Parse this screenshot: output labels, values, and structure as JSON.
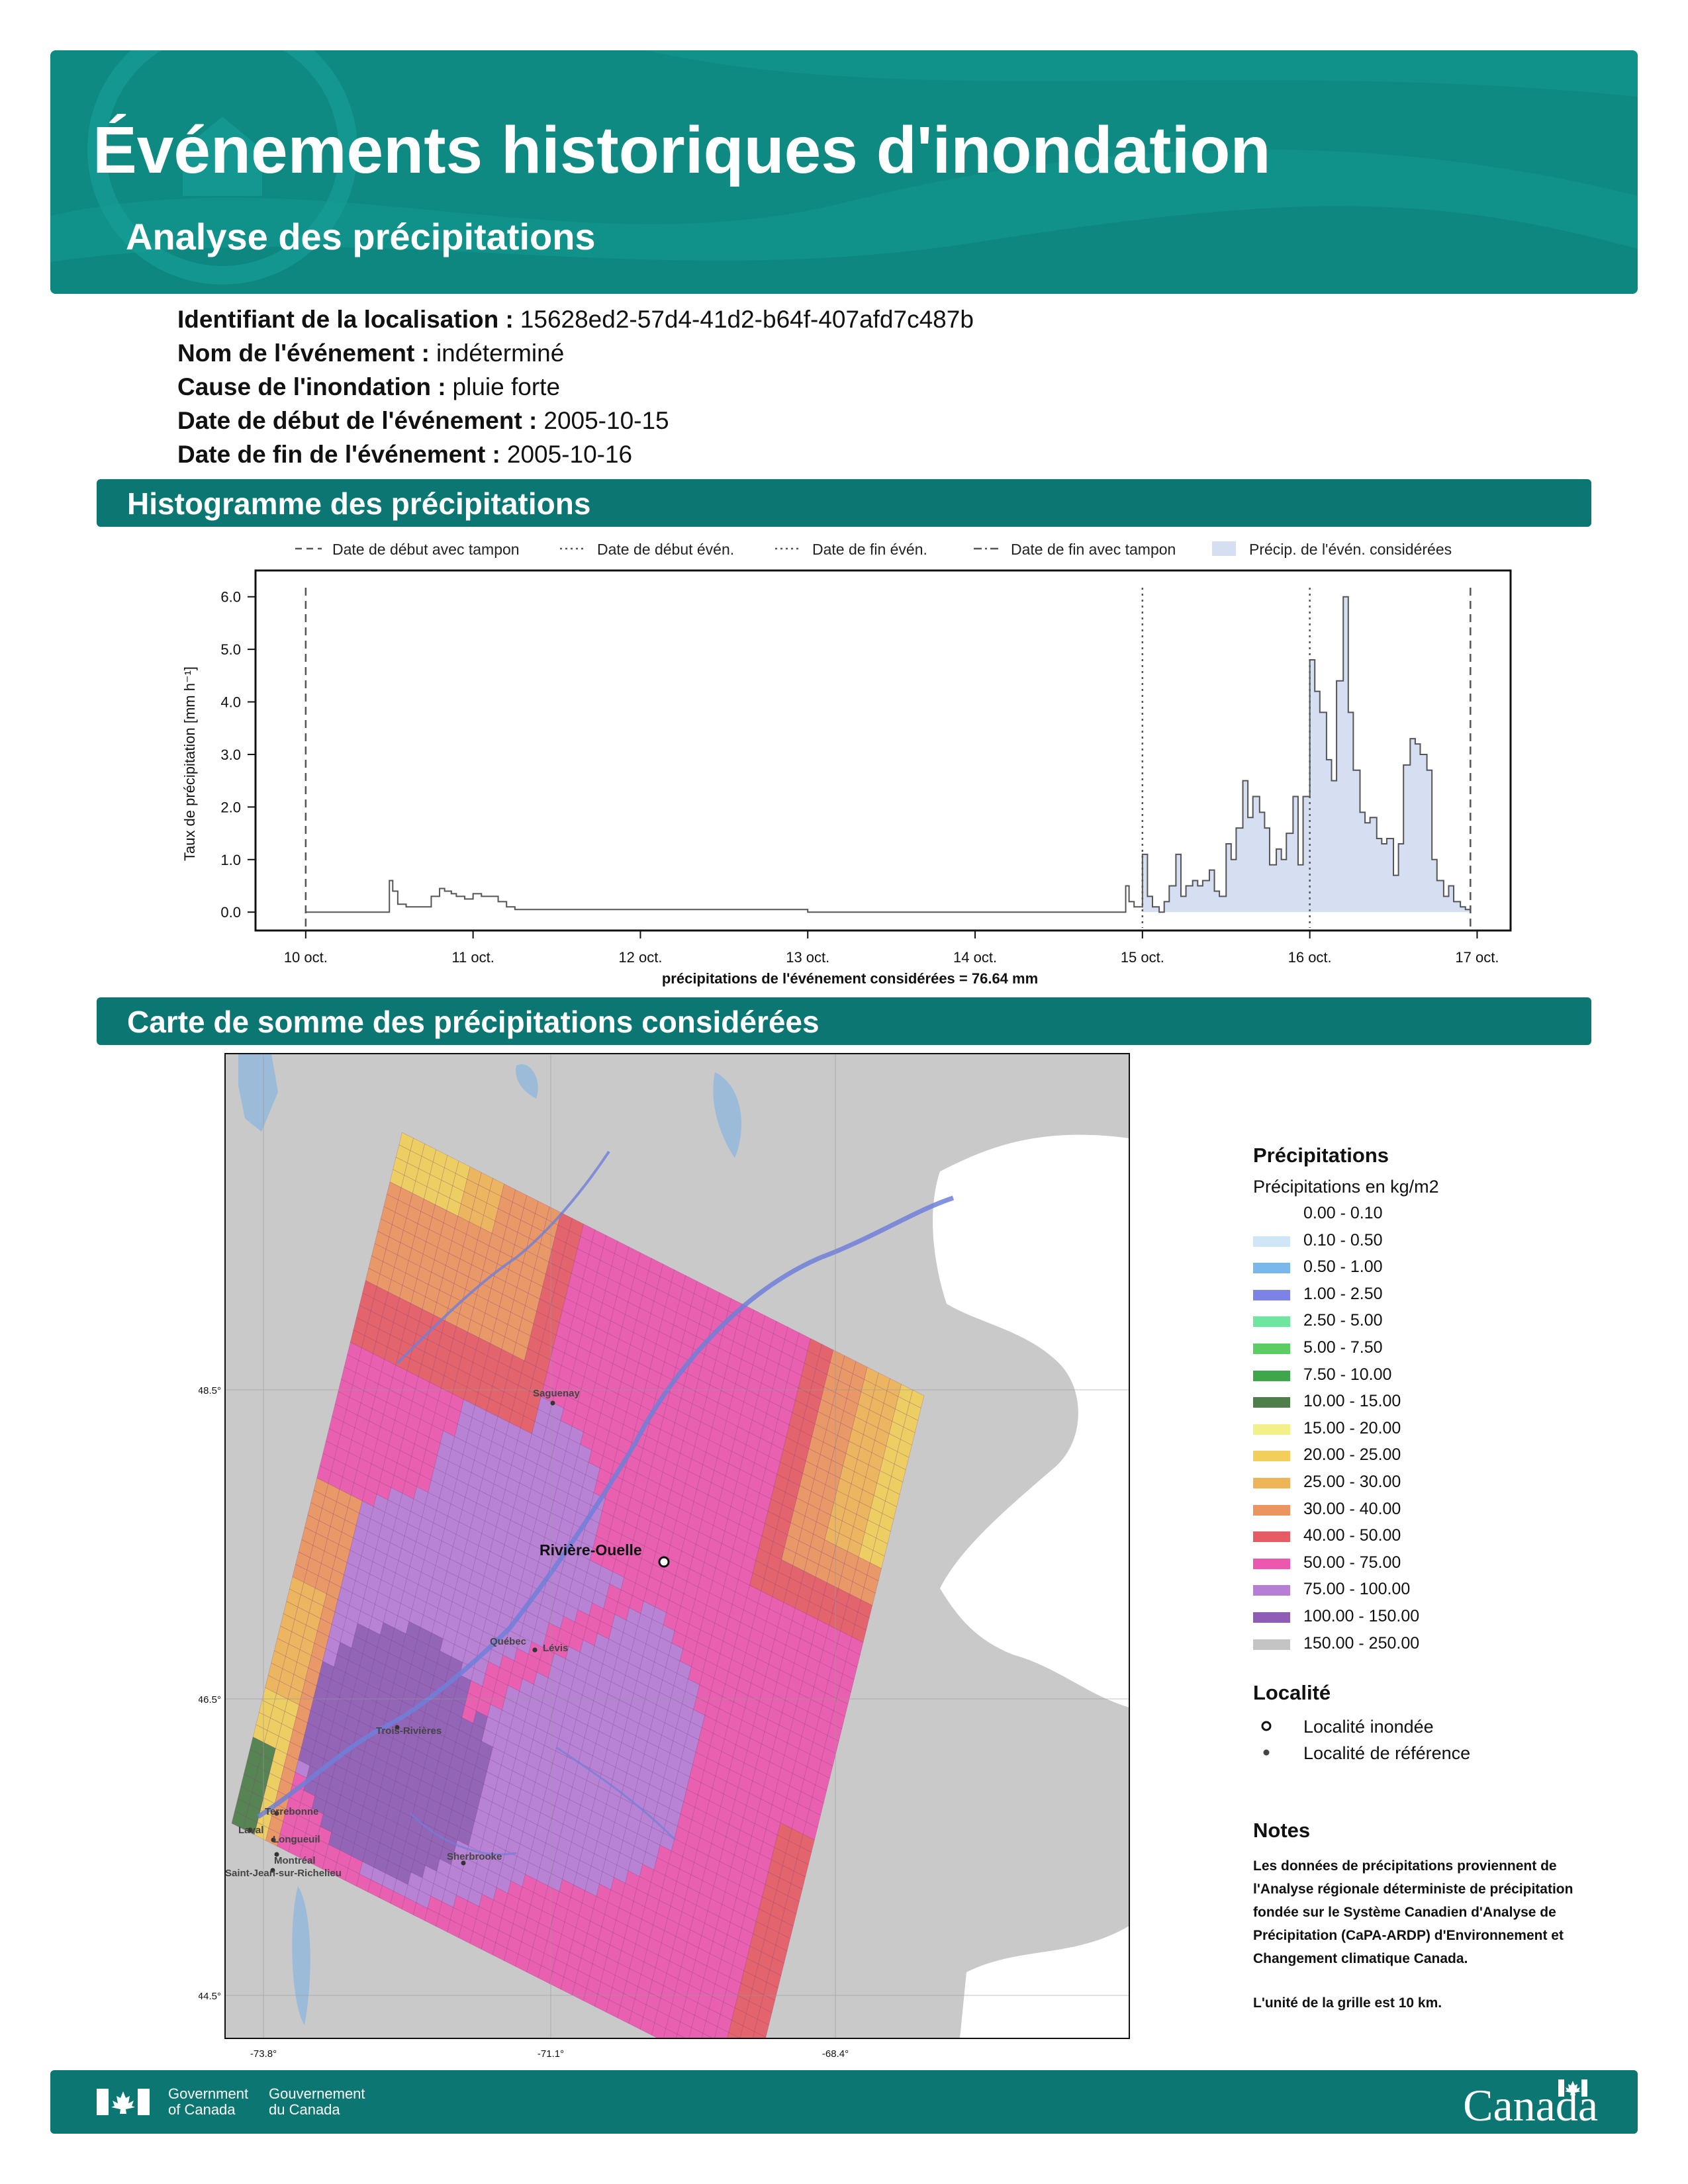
{
  "header": {
    "title": "Événements historiques d'inondation",
    "subtitle": "Analyse des précipitations",
    "brand_color": "#0e8a83",
    "section_color": "#0b7672"
  },
  "info": [
    {
      "label": "Identifiant de la localisation :",
      "value": "15628ed2-57d4-41d2-b64f-407afd7c487b"
    },
    {
      "label": "Nom de l'événement :",
      "value": "indéterminé"
    },
    {
      "label": "Cause de l'inondation :",
      "value": "pluie forte"
    },
    {
      "label": "Date de début de l'événement :",
      "value": "2005-10-15"
    },
    {
      "label": "Date de fin de l'événement :",
      "value": "2005-10-16"
    }
  ],
  "sections": {
    "histogram": "Histogramme des précipitations",
    "map": "Carte de somme des précipitations considérées"
  },
  "chart_data": {
    "type": "line",
    "ylabel": "Taux de précipitation [mm h⁻¹]",
    "xlabel": "précipitations de l'événement considérées = 76.64 mm",
    "ylim": [
      0,
      6.5
    ],
    "xlim_days": [
      9.7,
      17.2
    ],
    "yticks": [
      0.0,
      1.0,
      2.0,
      3.0,
      4.0,
      5.0,
      6.0
    ],
    "ytick_labels": [
      "0.0",
      "1.0",
      "2.0",
      "3.0",
      "4.0",
      "5.0",
      "6.0"
    ],
    "xticks": [
      10,
      11,
      12,
      13,
      14,
      15,
      16,
      17
    ],
    "xtick_labels": [
      "10 oct.",
      "11 oct.",
      "12 oct.",
      "13 oct.",
      "14 oct.",
      "15 oct.",
      "16 oct.",
      "17 oct."
    ],
    "legend": [
      {
        "label": "Date de début avec tampon",
        "style": "dashed"
      },
      {
        "label": "Date de début évén.",
        "style": "dotted"
      },
      {
        "label": "Date de fin évén.",
        "style": "dotted"
      },
      {
        "label": "Date de fin avec tampon",
        "style": "dashdot"
      },
      {
        "label": "Précip. de l'évén. considérées",
        "style": "fill"
      }
    ],
    "legend_position": "top",
    "grid": false,
    "vlines": [
      {
        "x": 10.0,
        "style": "dashed"
      },
      {
        "x": 15.0,
        "style": "dotted"
      },
      {
        "x": 16.0,
        "style": "dotted"
      },
      {
        "x": 16.96,
        "style": "dashed"
      }
    ],
    "fill_range": [
      15.0,
      16.96
    ],
    "fill_color": "#d5dff1",
    "x": [
      10.0,
      10.5,
      10.52,
      10.55,
      10.6,
      10.7,
      10.75,
      10.8,
      10.83,
      10.87,
      10.9,
      10.95,
      11.0,
      11.05,
      11.1,
      11.15,
      11.2,
      11.25,
      11.3,
      11.35,
      11.5,
      12.0,
      12.5,
      13.0,
      13.5,
      14.0,
      14.5,
      14.9,
      14.92,
      14.95,
      15.0,
      15.03,
      15.06,
      15.1,
      15.13,
      15.16,
      15.2,
      15.23,
      15.26,
      15.3,
      15.33,
      15.36,
      15.4,
      15.43,
      15.46,
      15.5,
      15.53,
      15.56,
      15.6,
      15.63,
      15.66,
      15.7,
      15.73,
      15.76,
      15.8,
      15.83,
      15.86,
      15.9,
      15.93,
      15.96,
      16.0,
      16.03,
      16.06,
      16.1,
      16.13,
      16.16,
      16.2,
      16.23,
      16.26,
      16.3,
      16.33,
      16.36,
      16.4,
      16.43,
      16.46,
      16.5,
      16.53,
      16.56,
      16.6,
      16.63,
      16.66,
      16.7,
      16.73,
      16.76,
      16.8,
      16.83,
      16.86,
      16.9,
      16.93
    ],
    "y": [
      0.0,
      0.6,
      0.4,
      0.15,
      0.1,
      0.1,
      0.3,
      0.45,
      0.4,
      0.35,
      0.3,
      0.25,
      0.35,
      0.3,
      0.3,
      0.2,
      0.1,
      0.05,
      0.05,
      0.05,
      0.05,
      0.05,
      0.05,
      0.0,
      0.0,
      0.0,
      0.0,
      0.5,
      0.2,
      0.1,
      1.1,
      0.3,
      0.1,
      0.0,
      0.2,
      0.5,
      1.1,
      0.3,
      0.5,
      0.6,
      0.5,
      0.6,
      0.8,
      0.4,
      0.3,
      1.3,
      1.0,
      1.6,
      2.5,
      1.8,
      2.2,
      1.9,
      1.6,
      0.9,
      1.2,
      1.0,
      1.5,
      2.2,
      0.9,
      2.2,
      4.8,
      4.2,
      3.8,
      2.9,
      2.5,
      4.4,
      6.0,
      3.8,
      2.7,
      1.9,
      1.7,
      1.8,
      1.4,
      1.3,
      1.4,
      0.7,
      1.3,
      2.8,
      3.3,
      3.2,
      3.0,
      2.7,
      1.0,
      0.6,
      0.3,
      0.5,
      0.2,
      0.1,
      0.05
    ]
  },
  "map": {
    "lat_labels": [
      "+48.5°",
      "+46.5°",
      "+44.5°"
    ],
    "lon_labels": [
      "-73.8°",
      "-71.1°",
      "-68.4°"
    ],
    "flood_locality": "Rivière-Ouelle",
    "reference_localities": [
      "Saguenay",
      "Québec",
      "Lévis",
      "Trois-Rivières",
      "Terrebonne",
      "Laval",
      "Longueuil",
      "Montréal",
      "Saint-Jean-sur-Richelieu",
      "Sherbrooke"
    ]
  },
  "legend": {
    "title": "Précipitations",
    "subtitle": "Précipitations en kg/m2",
    "bins": [
      {
        "label": "0.00 - 0.10",
        "color": "#ffffff"
      },
      {
        "label": "0.10 - 0.50",
        "color": "#cfe6f7"
      },
      {
        "label": "0.50 - 1.00",
        "color": "#7ab8ec"
      },
      {
        "label": "1.00 - 2.50",
        "color": "#7d83e6"
      },
      {
        "label": "2.50 - 5.00",
        "color": "#6fe6a0"
      },
      {
        "label": "5.00 - 7.50",
        "color": "#5ccd62"
      },
      {
        "label": "7.50 - 10.00",
        "color": "#3ea74a"
      },
      {
        "label": "10.00 - 15.00",
        "color": "#4e7f4a"
      },
      {
        "label": "15.00 - 20.00",
        "color": "#f3f08a"
      },
      {
        "label": "20.00 - 25.00",
        "color": "#f1cf5a"
      },
      {
        "label": "25.00 - 30.00",
        "color": "#efb458"
      },
      {
        "label": "30.00 - 40.00",
        "color": "#ec9460"
      },
      {
        "label": "40.00 - 50.00",
        "color": "#e65c65"
      },
      {
        "label": "50.00 - 75.00",
        "color": "#ec58ae"
      },
      {
        "label": "75.00 - 100.00",
        "color": "#b77ed6"
      },
      {
        "label": "100.00 - 150.00",
        "color": "#8f5db5"
      },
      {
        "label": "150.00 - 250.00",
        "color": "#c4c4c4"
      }
    ],
    "locality_title": "Localité",
    "locality_flooded": "Localité inondée",
    "locality_reference": "Localité de référence"
  },
  "notes": {
    "title": "Notes",
    "paragraph1": "Les données de précipitations proviennent de l'Analyse régionale déterministe de précipitation fondée sur le Système Canadien d'Analyse de Précipitation (CaPA-ARDP) d'Environnement et Changement climatique Canada.",
    "paragraph2": "L'unité de la grille est 10 km."
  },
  "footer": {
    "gov_en_1": "Government",
    "gov_en_2": "of Canada",
    "gov_fr_1": "Gouvernement",
    "gov_fr_2": "du Canada",
    "wordmark": "Canada"
  }
}
